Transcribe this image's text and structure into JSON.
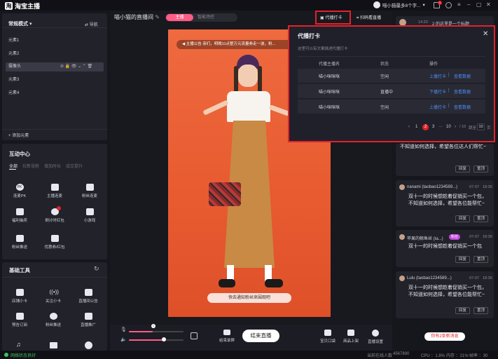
{
  "app": {
    "name": "淘宝主播",
    "user": "喵小猫最多8个字..."
  },
  "left": {
    "mode_label": "常规模式",
    "guide_label": "导航",
    "elements": [
      "元素1",
      "元素2",
      "摄像头",
      "元素3",
      "元素4"
    ],
    "add_element": "添加元素",
    "interaction": {
      "title": "互动中心",
      "tabs": [
        "全部",
        "拉新涨粉",
        "增加时长",
        "成交提升"
      ],
      "tools": [
        "连麦PK",
        "主播连麦",
        "粉丝连麦",
        "福利抽奖",
        "倒计时红包",
        "小游戏",
        "粉丝推送",
        "优惠券/红包"
      ]
    },
    "basic": {
      "title": "基础工具",
      "tools": [
        "店铺小卡",
        "关注小卡",
        "直播间公告",
        "预告订阅",
        "粉丝推送",
        "直播推广"
      ]
    }
  },
  "center": {
    "room_title": "喵小猫的直播间",
    "mode_tabs": [
      "主播",
      "智能场控"
    ],
    "notice": "主播公告 亲们，明晚11点整万元流量券走一波，粉...",
    "proxy_button": "代播打卡",
    "scan_button": "扫码看直播",
    "video_caption": "快去通知粉丝来围观吧",
    "controls": {
      "record": "结束录屏",
      "end_live": "结束直播",
      "store": "宝贝口袋",
      "publish": "商品上架",
      "settings": "直播设置"
    }
  },
  "popup": {
    "title": "代播打卡",
    "subtitle": "这里可以有文案描述代播打卡",
    "headers": [
      "代播主播名",
      "状态",
      "操作"
    ],
    "rows": [
      {
        "name": "喵小咪咪咪",
        "status": "空闲",
        "action": "上播打卡",
        "view": "查看数据"
      },
      {
        "name": "喵小咪咪咪",
        "status": "直播中",
        "action": "下播打卡",
        "view": "查看数据"
      },
      {
        "name": "喵小咪咪咪",
        "status": "空闲",
        "action": "上播打卡",
        "view": "查看数据"
      }
    ],
    "pagination": {
      "pages": [
        "1",
        "2",
        "3",
        "10"
      ],
      "current": "2",
      "total": "/ 10",
      "jump": "跳至",
      "jump_value": "10",
      "unit": "页"
    }
  },
  "chat": {
    "first_time": "14:20",
    "first_name": "2 的这里是一个标题",
    "first_msg": "不知道如何选择，希望各位达人们帮忙~",
    "reply": "回复",
    "pin": "置顶",
    "messages": [
      {
        "name": "nanami (taobao1234589...)",
        "date": "07-07",
        "time": "18:36",
        "text": "双十一的时候想趁着促销买一个包，不知道如何选择，希望各位能帮忙~"
      },
      {
        "name": "苹果的鲸鱼丝 (ta...)",
        "badge": "粉丝",
        "date": "07-07",
        "time": "18:36",
        "text": "双十一的时候想趁着促销买一个包"
      },
      {
        "name": "Lulu (taobao1234589...)",
        "date": "07-07",
        "time": "18:36",
        "text": "双十一的时候想趁着促销买一个包，不知道如何选择，希望各位能帮忙~"
      }
    ],
    "new_msgs": "你有2条新消息"
  },
  "status": {
    "net": "网络状态良好",
    "viewers_label": "当前在线人数",
    "viewers": "4567890",
    "cpu": "CPU ：1.8%",
    "memory": "内存 ：21%",
    "fps": "帧率 ：30"
  },
  "colors": {
    "accent": "#e1222b",
    "pink": "#ff5c86",
    "link": "#4a8ef7",
    "bg": "#16161d"
  }
}
